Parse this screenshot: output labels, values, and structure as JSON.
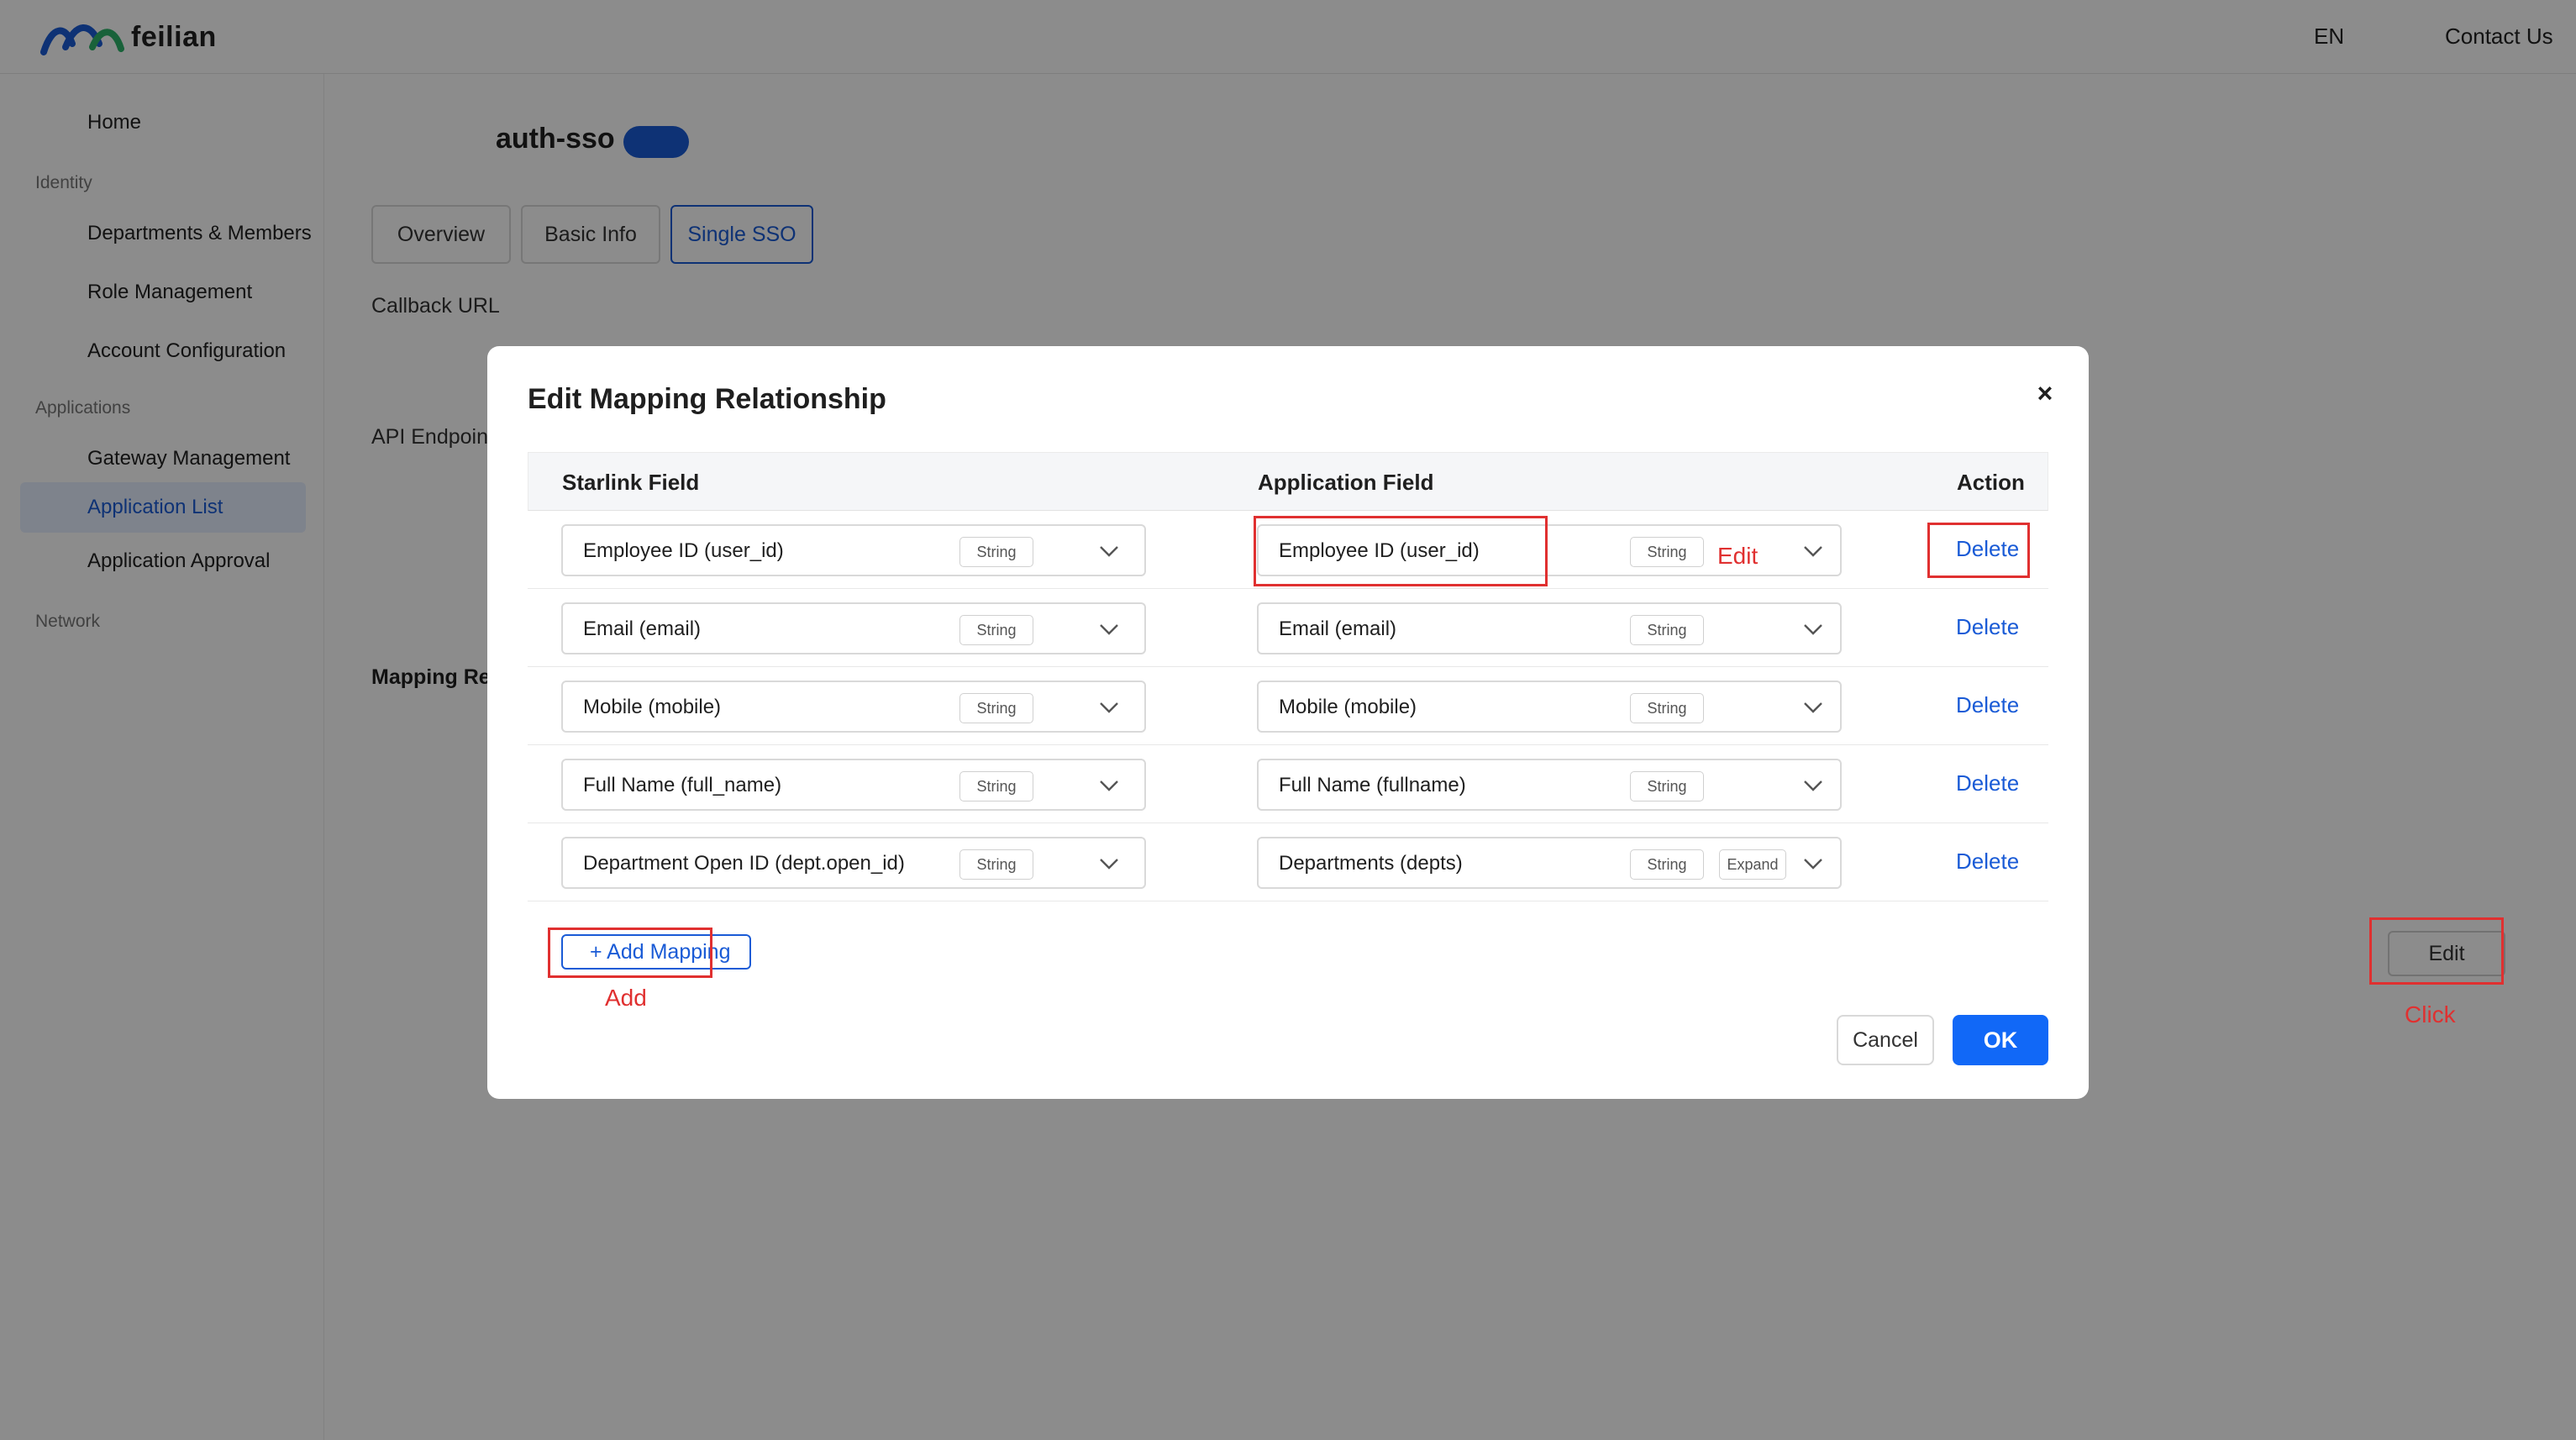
{
  "header": {
    "brand": "feilian",
    "lang": "EN",
    "contact": "Contact Us"
  },
  "sidebar": {
    "home": "Home",
    "group_identity": "Identity",
    "departments": "Departments & Members",
    "roles": "Role Management",
    "account_config": "Account Configuration",
    "group_applications": "Applications",
    "gateway": "Gateway Management",
    "app_list": "Application List",
    "app_approval": "Application Approval",
    "group_network": "Network"
  },
  "main": {
    "app_title": "auth-sso",
    "tabs": [
      {
        "label": "Overview"
      },
      {
        "label": "Basic Info"
      },
      {
        "label": "Single SSO"
      }
    ],
    "callback_label": "Callback URL",
    "api_label": "API Endpoin",
    "mapping_label": "Mapping Re",
    "edit_button": "Edit"
  },
  "annotations": {
    "edit": "Edit",
    "add": "Add",
    "click": "Click"
  },
  "modal": {
    "title": "Edit Mapping Relationship",
    "close": "×",
    "columns": {
      "starlink": "Starlink Field",
      "application": "Application Field",
      "action": "Action"
    },
    "rows": [
      {
        "starlink": "Employee ID (user_id)",
        "starlink_type": "String",
        "application": "Employee ID (user_id)",
        "application_type": "String",
        "action": "Delete"
      },
      {
        "starlink": "Email (email)",
        "starlink_type": "String",
        "application": "Email (email)",
        "application_type": "String",
        "action": "Delete"
      },
      {
        "starlink": "Mobile (mobile)",
        "starlink_type": "String",
        "application": "Mobile (mobile)",
        "application_type": "String",
        "action": "Delete"
      },
      {
        "starlink": "Full Name (full_name)",
        "starlink_type": "String",
        "application": "Full Name (fullname)",
        "application_type": "String",
        "action": "Delete"
      },
      {
        "starlink": "Department Open ID (dept.open_id)",
        "starlink_type": "String",
        "application": "Departments (depts)",
        "application_type": "String",
        "application_extra": "Expand",
        "action": "Delete"
      }
    ],
    "add_mapping": "+ Add Mapping",
    "cancel": "Cancel",
    "ok": "OK"
  },
  "colors": {
    "primary": "#1168f7",
    "link": "#1a5bd6",
    "annotation": "#e03030"
  }
}
